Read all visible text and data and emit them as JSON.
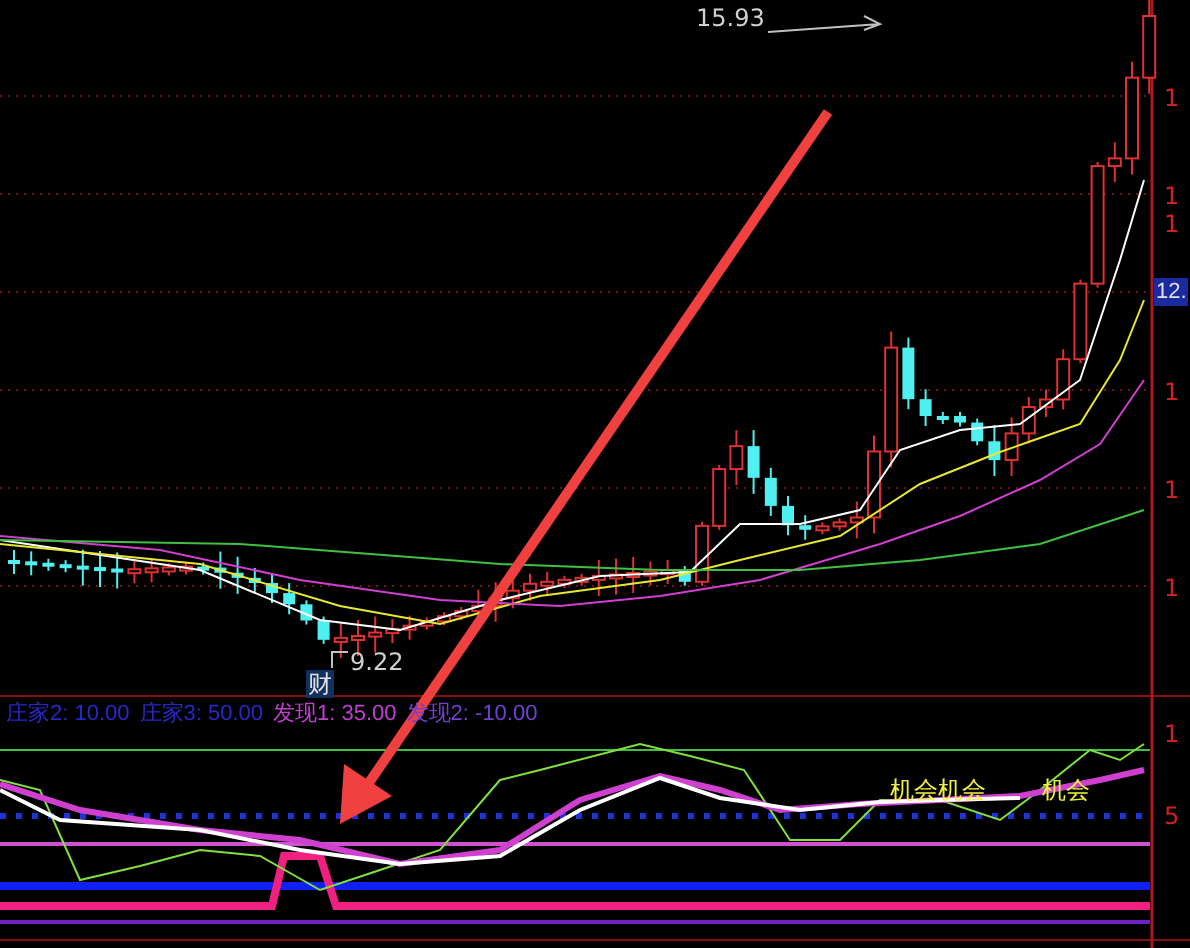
{
  "price_chart": {
    "high_label": "15.93",
    "low_label": "9.22",
    "marker": "财",
    "current_price": "12.",
    "axis_labels": [
      "1",
      "1",
      "1",
      "1",
      "1",
      "1"
    ]
  },
  "indicator": {
    "legend": [
      {
        "text": "庄家2: 10.00",
        "color": "#2828c8"
      },
      {
        "text": "庄家3: 50.00",
        "color": "#2828c8"
      },
      {
        "text": "发现1: 35.00",
        "color": "#c040d0"
      },
      {
        "text": "发现2: -10.00",
        "color": "#7040d0"
      }
    ],
    "signals": [
      "机会机会",
      "机会"
    ],
    "axis_labels": [
      "1",
      "5"
    ]
  }
}
